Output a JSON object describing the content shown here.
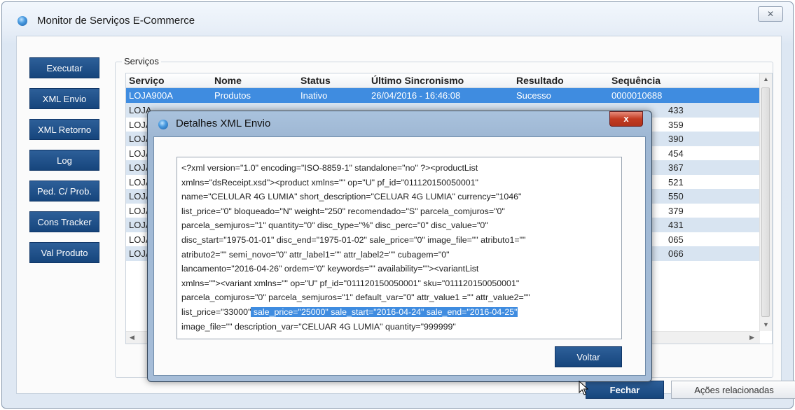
{
  "window": {
    "title": "Monitor de Serviços E-Commerce",
    "close_glyph": "✕"
  },
  "left_buttons": [
    "Executar",
    "XML Envio",
    "XML Retorno",
    "Log",
    "Ped. C/ Prob.",
    "Cons Tracker",
    "Val Produto"
  ],
  "services": {
    "legend": "Serviços",
    "columns": [
      "Serviço",
      "Nome",
      "Status",
      "Último Sincronismo",
      "Resultado",
      "Sequência"
    ],
    "selected_row": [
      "LOJA900A",
      "Produtos",
      "Inativo",
      "26/04/2016 - 16:46:08",
      "Sucesso",
      "0000010688"
    ],
    "partial_rows": [
      {
        "servico": "LOJA",
        "seq": "433"
      },
      {
        "servico": "LOJA",
        "seq": "359"
      },
      {
        "servico": "LOJA",
        "seq": "390"
      },
      {
        "servico": "LOJA",
        "seq": "454"
      },
      {
        "servico": "LOJA",
        "seq": "367"
      },
      {
        "servico": "LOJA",
        "seq": "521"
      },
      {
        "servico": "LOJA",
        "seq": "550"
      },
      {
        "servico": "LOJA",
        "seq": "379"
      },
      {
        "servico": "LOJA",
        "seq": "431"
      },
      {
        "servico": "LOJA",
        "seq": "065"
      },
      {
        "servico": "LOJA",
        "seq": "066"
      }
    ]
  },
  "footer": {
    "fechar": "Fechar",
    "acoes": "Ações relacionadas"
  },
  "dialog": {
    "title": "Detalhes XML Envio",
    "close_glyph": "x",
    "voltar": "Voltar",
    "xml_lines": [
      "<?xml version=\"1.0\" encoding=\"ISO-8859-1\" standalone=\"no\" ?><productList",
      "xmlns=\"dsReceipt.xsd\"><product xmlns=\"\" op=\"U\" pf_id=\"011120150050001\"",
      "name=\"CELULAR 4G LUMIA\" short_description=\"CELUAR 4G LUMIA\" currency=\"1046\"",
      "list_price=\"0\" bloqueado=\"N\" weight=\"250\" recomendado=\"S\" parcela_comjuros=\"0\"",
      "parcela_semjuros=\"1\" quantity=\"0\" disc_type=\"%\" disc_perc=\"0\" disc_value=\"0\"",
      "disc_start=\"1975-01-01\" disc_end=\"1975-01-02\" sale_price=\"0\" image_file=\"\" atributo1=\"\"",
      "atributo2=\"\" semi_novo=\"0\" attr_label1=\"\" attr_label2=\"\" cubagem=\"0\"",
      "lancamento=\"2016-04-26\" ordem=\"0\" keywords=\"\" availability=\"\"><variantList",
      "xmlns=\"\"><variant xmlns=\"\" op=\"U\" pf_id=\"011120150050001\" sku=\"011120150050001\"",
      "parcela_comjuros=\"0\" parcela_semjuros=\"1\" default_var=\"0\" attr_value1 =\"\" attr_value2=\"\""
    ],
    "line11_plain": "list_price=\"33000\"",
    "line11_highlight": " sale_price=\"25000\" sale_start=\"2016-04-24\" sale_end=\"2016-04-25\"",
    "line12": "image_file=\"\" description_var=\"CELUAR 4G LUMIA\" quantity=\"999999\""
  }
}
